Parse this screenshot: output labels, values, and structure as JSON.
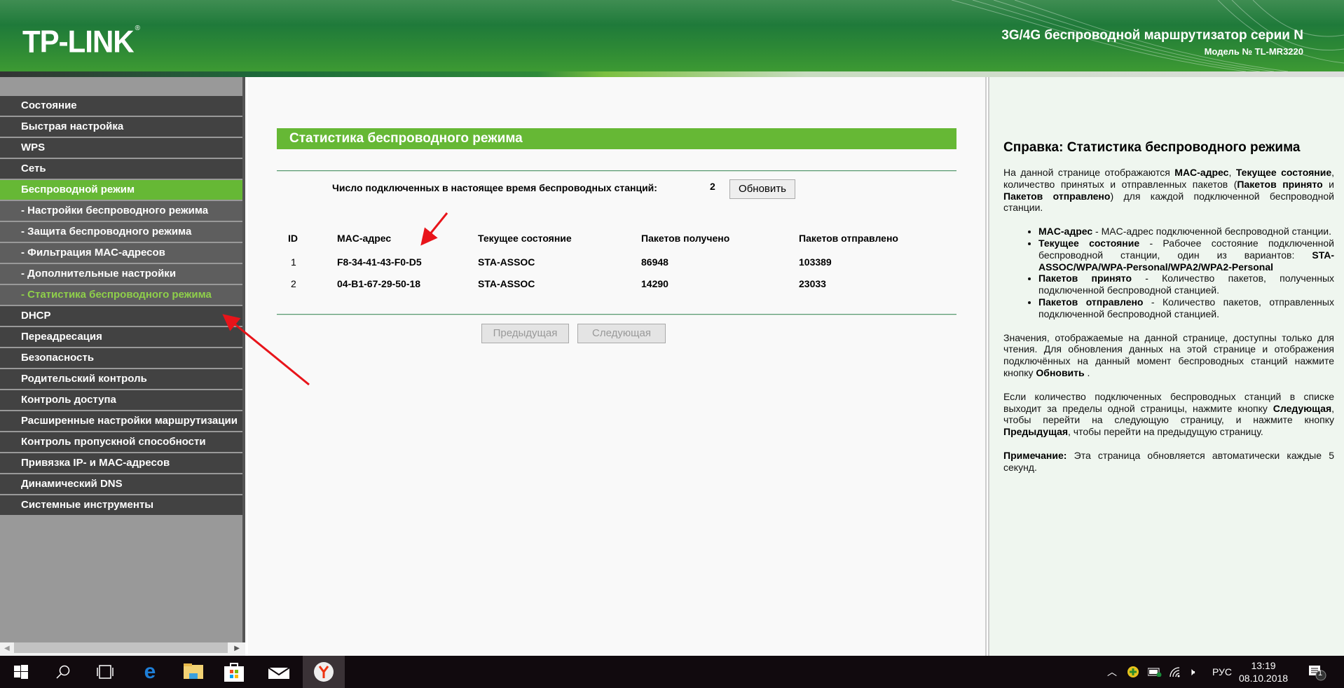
{
  "header": {
    "logo": "TP-LINK",
    "product": "3G/4G беспроводной маршрутизатор серии N",
    "model": "Модель № TL-MR3220"
  },
  "sidebar": {
    "items": [
      {
        "label": "Состояние",
        "type": "main"
      },
      {
        "label": "Быстрая настройка",
        "type": "main"
      },
      {
        "label": "WPS",
        "type": "main"
      },
      {
        "label": "Сеть",
        "type": "main"
      },
      {
        "label": "Беспроводной режим",
        "type": "active"
      },
      {
        "label": "- Настройки беспроводного режима",
        "type": "sub"
      },
      {
        "label": "- Защита беспроводного режима",
        "type": "sub"
      },
      {
        "label": "- Фильтрация MAC-адресов",
        "type": "sub"
      },
      {
        "label": "- Дополнительные настройки",
        "type": "sub"
      },
      {
        "label": "- Статистика беспроводного режима",
        "type": "current"
      },
      {
        "label": "DHCP",
        "type": "main"
      },
      {
        "label": "Переадресация",
        "type": "main"
      },
      {
        "label": "Безопасность",
        "type": "main"
      },
      {
        "label": "Родительский контроль",
        "type": "main"
      },
      {
        "label": "Контроль доступа",
        "type": "main"
      },
      {
        "label": "Расширенные настройки маршрутизации",
        "type": "main"
      },
      {
        "label": "Контроль пропускной способности",
        "type": "main"
      },
      {
        "label": "Привязка IP- и MAC-адресов",
        "type": "main"
      },
      {
        "label": "Динамический DNS",
        "type": "main"
      },
      {
        "label": "Системные инструменты",
        "type": "main"
      }
    ]
  },
  "main": {
    "title": "Статистика беспроводного режима",
    "count_label": "Число подключенных в настоящее время беспроводных станций:",
    "count_value": "2",
    "refresh": "Обновить",
    "columns": [
      "ID",
      "MAC-адрес",
      "Текущее состояние",
      "Пакетов получено",
      "Пакетов отправлено"
    ],
    "rows": [
      [
        "1",
        "F8-34-41-43-F0-D5",
        "STA-ASSOC",
        "86948",
        "103389"
      ],
      [
        "2",
        "04-B1-67-29-50-18",
        "STA-ASSOC",
        "14290",
        "23033"
      ]
    ],
    "prev": "Предыдущая",
    "next": "Следующая"
  },
  "help": {
    "title": "Справка: Статистика беспроводного режима",
    "p1": [
      "На данной странице отображаются ",
      "MAC-адрес",
      ", ",
      "Текущее состояние",
      ", количество принятых и отправленных пакетов (",
      "Пакетов принято",
      " и ",
      "Пакетов отправлено",
      ") для каждой подключенной беспроводной станции."
    ],
    "bullets": [
      {
        "term": "MAC-адрес",
        "text": " - MAC-адрес подключенной беспроводной станции."
      },
      {
        "term": "Текущее состояние",
        "text": " - Рабочее состояние подключенной беспроводной станции, один из вариантов: ",
        "extra": "STA-ASSOC/WPA/WPA-Personal/WPA2/WPA2-Personal"
      },
      {
        "term": "Пакетов принято",
        "text": " - Количество пакетов, полученных подключенной беспроводной станцией."
      },
      {
        "term": "Пакетов отправлено",
        "text": " - Количество пакетов, отправленных подключенной беспроводной станцией."
      }
    ],
    "p2": [
      "Значения, отображаемые на данной странице, доступны только для чтения. Для обновления данных на этой странице и отображения подключённых на данный момент беспроводных станций нажмите кнопку ",
      "Обновить",
      " ."
    ],
    "p3": [
      "Если количество подключенных беспроводных станций в списке выходит за пределы одной страницы, нажмите кнопку ",
      "Следующая",
      ", чтобы перейти на следующую страницу, и нажмите кнопку ",
      "Предыдущая",
      ", чтобы перейти на предыдущую страницу."
    ],
    "p4": [
      "Примечание:",
      " Эта страница обновляется автоматически каждые 5 секунд."
    ]
  },
  "taskbar": {
    "lang": "РУС",
    "time": "13:19",
    "date": "08.10.2018",
    "notifications": "1"
  },
  "colors": {
    "green": "#66b835",
    "menu": "#424242",
    "submenu": "#5e5e5e",
    "current": "#8fd04a",
    "arrow": "#e8141a"
  }
}
